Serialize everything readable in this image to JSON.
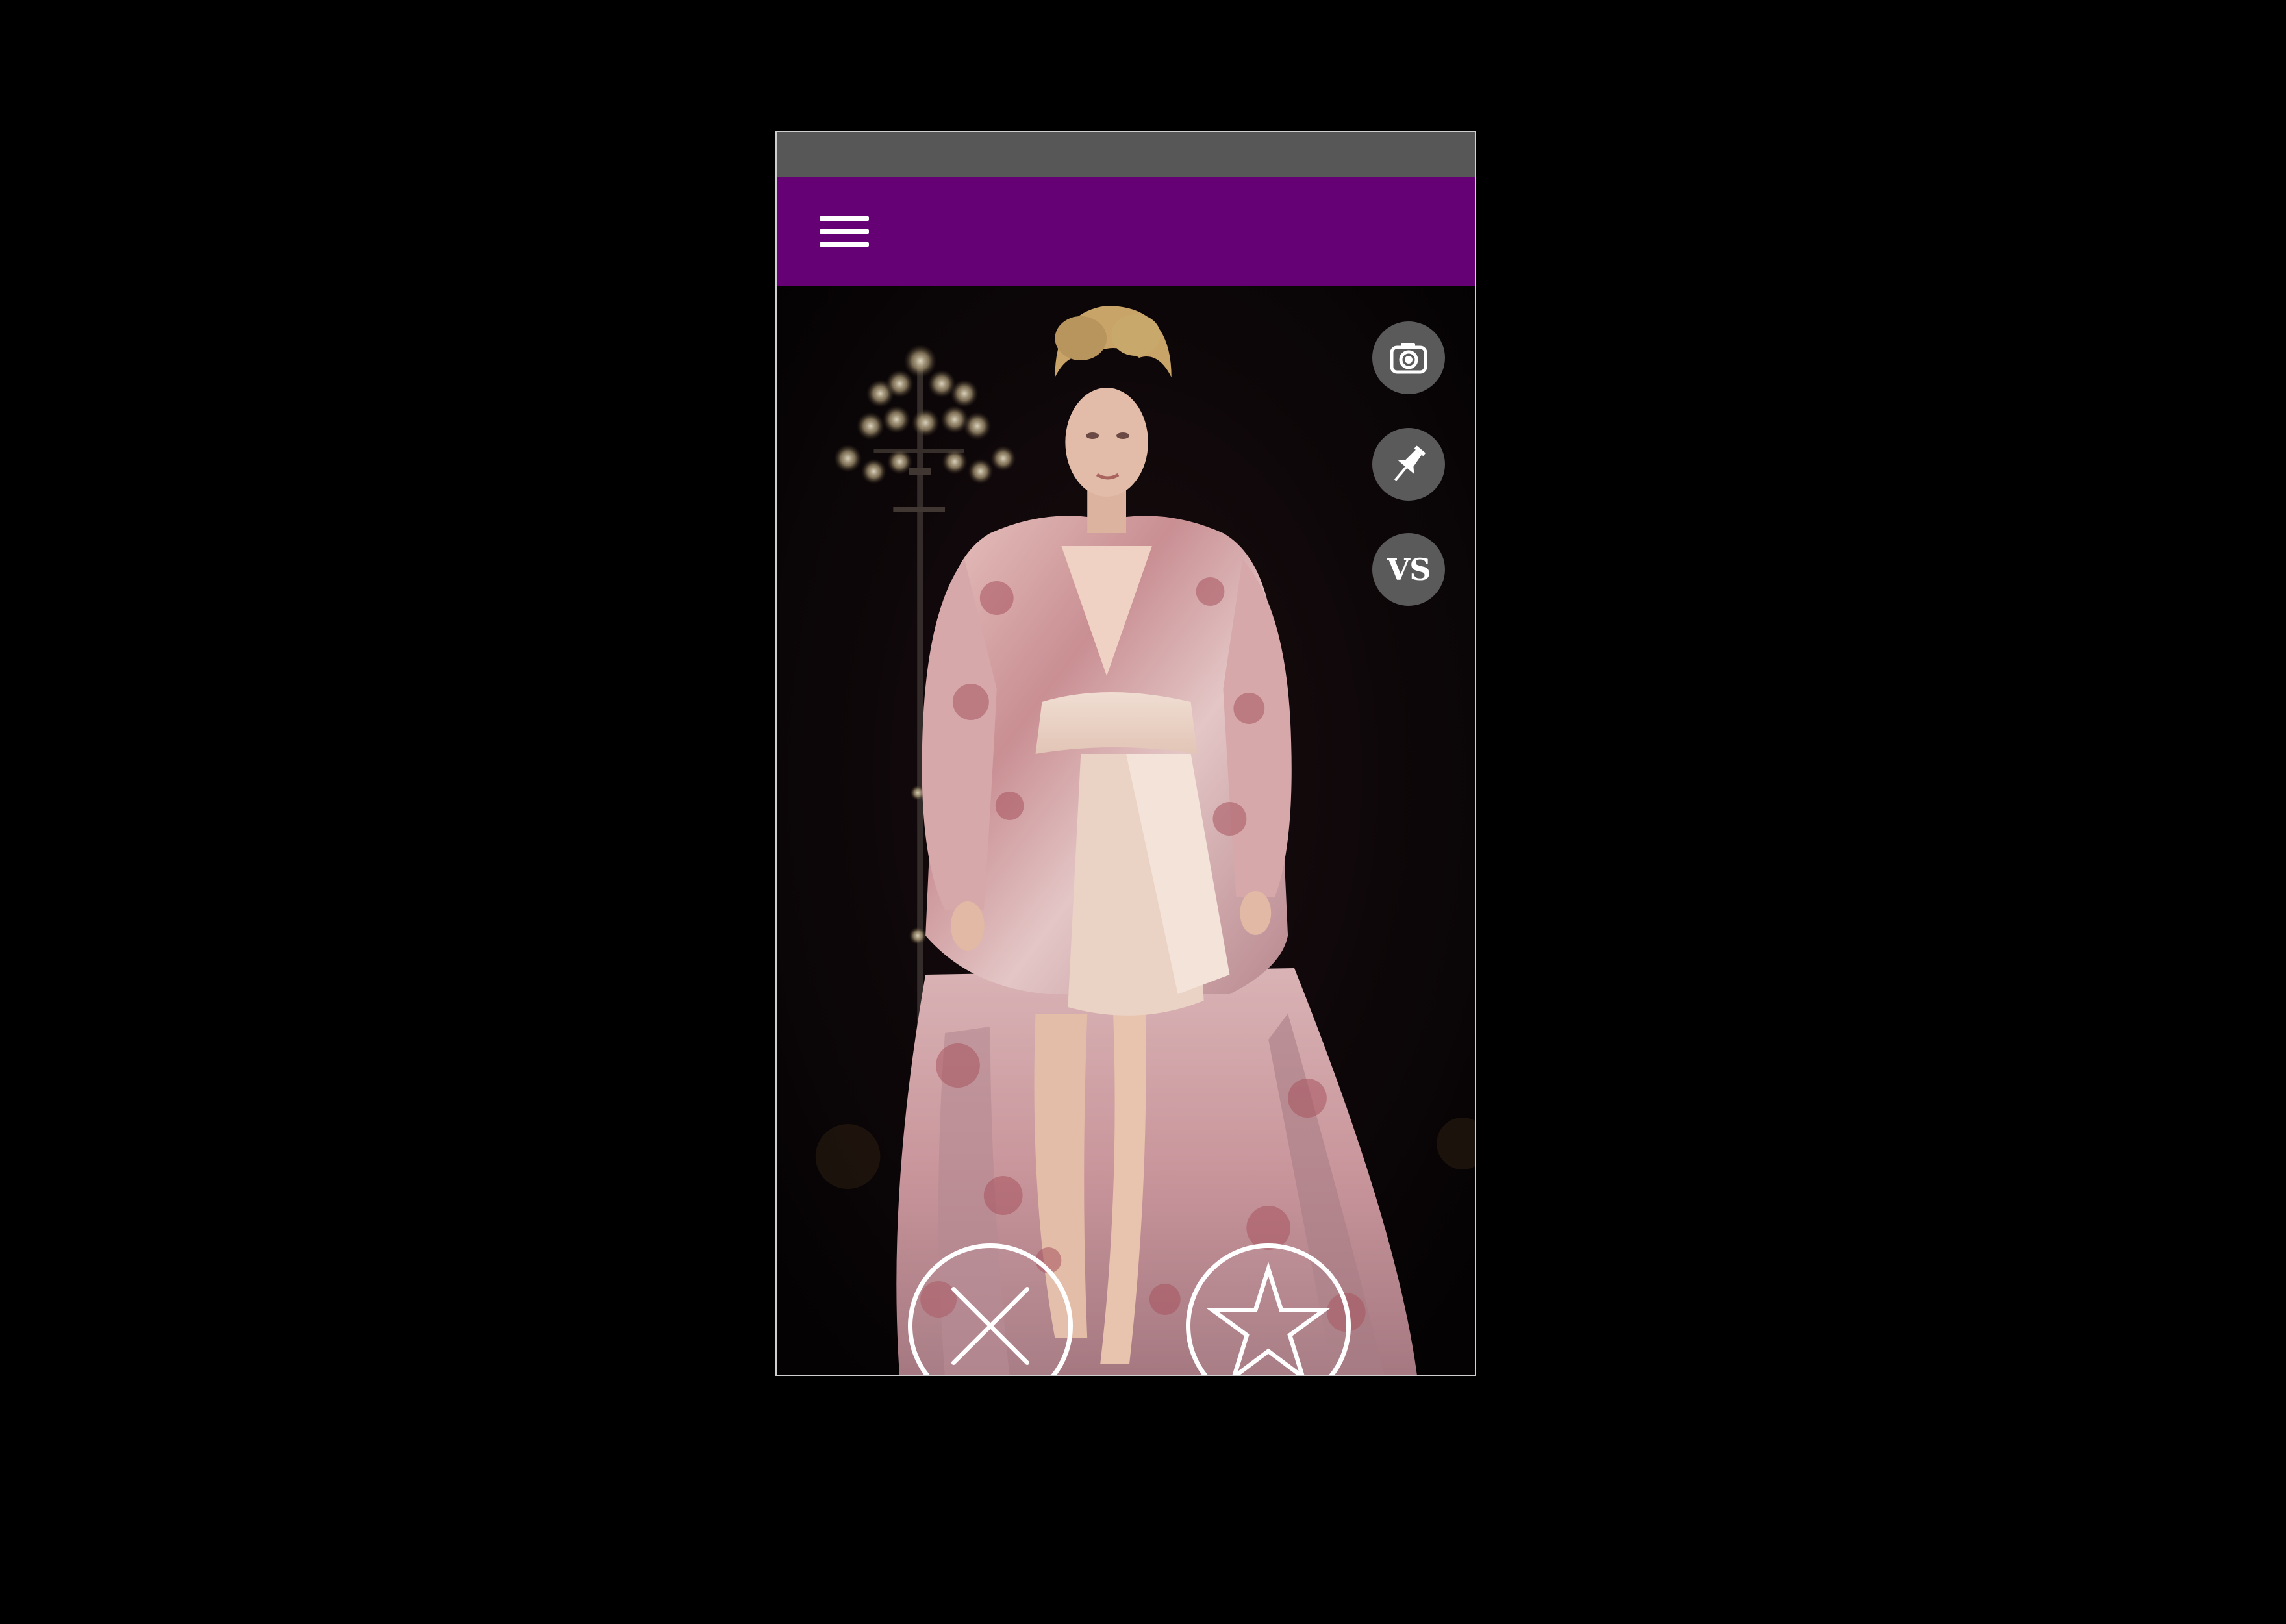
{
  "colors": {
    "background": "#000000",
    "status_bar": "#575757",
    "app_bar": "#650075",
    "icon_button": "#5a5a5a",
    "icon_foreground": "#ffffff"
  },
  "app_bar": {
    "menu_icon": "hamburger-menu-icon"
  },
  "side_actions": [
    {
      "icon": "camera-icon"
    },
    {
      "icon": "pushpin-icon"
    },
    {
      "icon": "versus-icon",
      "label": "VS"
    }
  ],
  "bottom_actions": [
    {
      "icon": "close-x-icon"
    },
    {
      "icon": "star-icon"
    }
  ]
}
